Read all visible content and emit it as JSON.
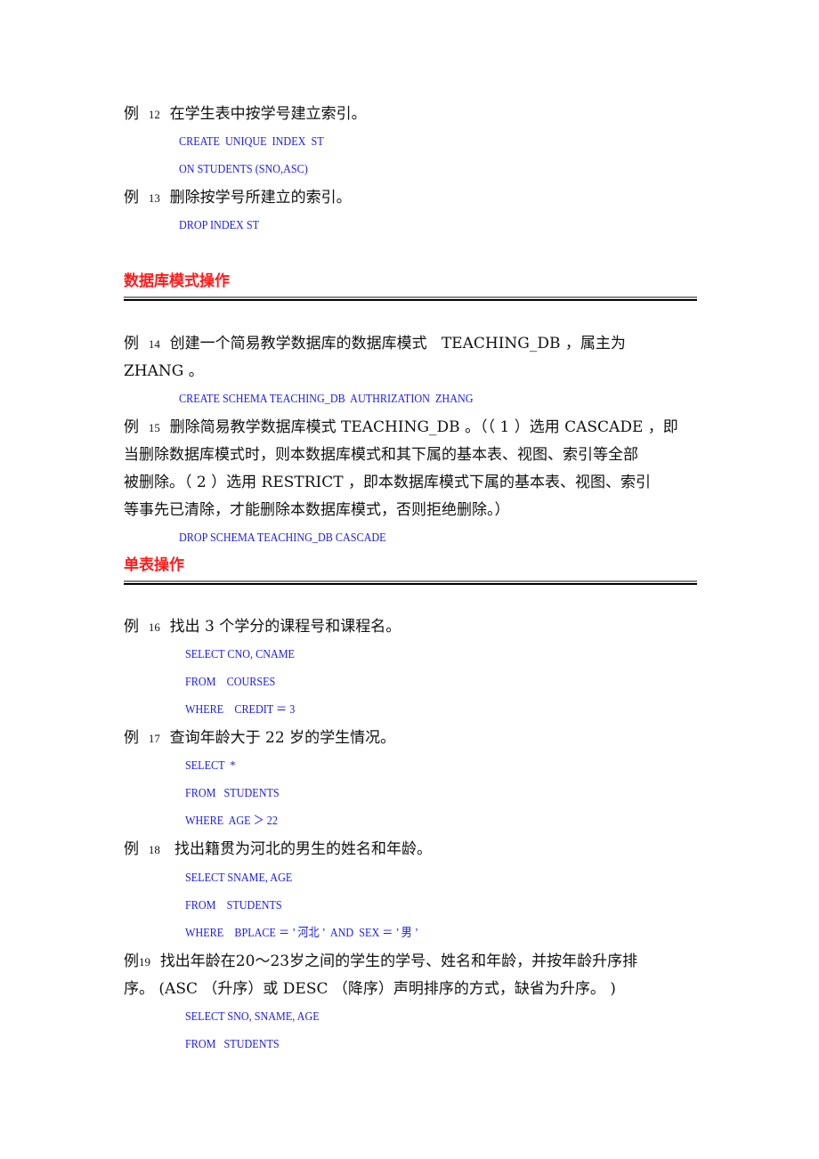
{
  "sections": {
    "schema_heading": "数据库模式操作",
    "single_table_heading": "单表操作"
  },
  "examples": [
    {
      "label": "例",
      "num": "12",
      "text": [
        "在学生表中按学号建立索引。"
      ],
      "code": [
        "CREATE  UNIQUE  INDEX  ST",
        "ON STUDENTS (SNO,ASC)"
      ]
    },
    {
      "label": "例",
      "num": "13",
      "text": [
        "删除按学号所建立的索引。"
      ],
      "code": [
        "DROP INDEX ST"
      ]
    },
    {
      "label": "例",
      "num": "14",
      "text": [
        "创建一个简易教学数据库的数据库模式   TEACHING_DB ，属主为",
        "ZHANG 。"
      ],
      "code": [
        "CREATE SCHEMA TEACHING_DB  AUTHRIZATION  ZHANG"
      ]
    },
    {
      "label": "例",
      "num": "15",
      "text": [
        "删除简易教学数据库模式 TEACHING_DB 。（（ 1 ）选用 CASCADE ，即",
        "当删除数据库模式时，则本数据库模式和其下属的基本表、视图、索引等全部",
        "被删除。（ 2 ）选用 RESTRICT ，即本数据库模式下属的基本表、视图、索引",
        "等事先已清除，才能删除本数据库模式，否则拒绝删除。）"
      ],
      "code": [
        "DROP SCHEMA TEACHING_DB CASCADE"
      ]
    },
    {
      "label": "例",
      "num": "16",
      "text": [
        "找出 3 个学分的课程号和课程名。"
      ],
      "code": [
        "SELECT CNO, CNAME",
        "FROM    COURSES",
        "WHERE    CREDIT ＝ 3"
      ]
    },
    {
      "label": "例",
      "num": "17",
      "text": [
        "查询年龄大于 22 岁的学生情况。"
      ],
      "code": [
        "SELECT  *",
        "FROM   STUDENTS",
        "WHERE  AGE ＞ 22"
      ]
    },
    {
      "label": "例",
      "num": "18",
      "text": [
        "找出籍贯为河北的男生的姓名和年龄。"
      ],
      "code": [
        "SELECT SNAME, AGE",
        "FROM    STUDENTS",
        "WHERE    BPLACE ＝ ’ 河北 ’  AND  SEX ＝ ’ 男 ’"
      ]
    },
    {
      "label": "例",
      "num": "19",
      "text": [
        "找出年龄在20～23岁之间的学生的学号、姓名和年龄，并按年龄升序排",
        "序。 (ASC （升序）或 DESC （降序）声明排序的方式，缺省为升序。 )"
      ],
      "code": [
        "SELECT SNO, SNAME, AGE",
        "FROM   STUDENTS"
      ]
    }
  ]
}
